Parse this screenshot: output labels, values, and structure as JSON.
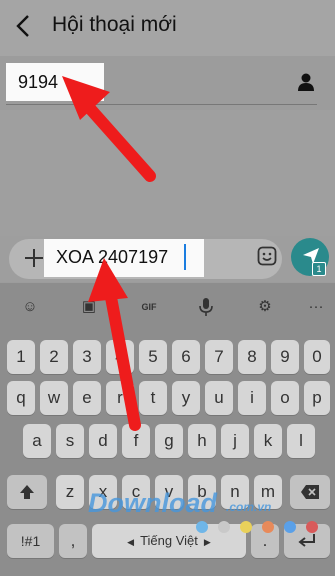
{
  "header": {
    "title": "Hội thoại mới",
    "back_icon": "back-arrow-icon"
  },
  "recipient": {
    "value": "9194",
    "contact_icon": "person-icon"
  },
  "compose": {
    "input_value": "XOA 2407197",
    "plus_icon": "plus-icon",
    "sticker_icon": "sticker-icon",
    "send_icon": "send-icon",
    "send_badge": "1"
  },
  "keyboard": {
    "toolbar": [
      "emoji-icon",
      "image-icon",
      "GIF",
      "mic-icon",
      "settings-icon",
      "more-icon"
    ],
    "gif_label": "GIF",
    "row_numbers": [
      "1",
      "2",
      "3",
      "4",
      "5",
      "6",
      "7",
      "8",
      "9",
      "0"
    ],
    "row_q": [
      "q",
      "w",
      "e",
      "r",
      "t",
      "y",
      "u",
      "i",
      "o",
      "p"
    ],
    "row_a": [
      "a",
      "s",
      "d",
      "f",
      "g",
      "h",
      "j",
      "k",
      "l"
    ],
    "row_z": [
      "z",
      "x",
      "c",
      "v",
      "b",
      "n",
      "m"
    ],
    "symbols_label": "!#1",
    "comma_label": ",",
    "space_label": "Tiếng Việt",
    "period_label": ".",
    "enter_icon": "enter-icon",
    "shift_icon": "shift-icon",
    "backspace_icon": "backspace-icon"
  },
  "watermark": {
    "brand": "Download",
    "domain": ".com.vn",
    "dot_colors": [
      "#6fb6e8",
      "#c9c9c9",
      "#e9d15a",
      "#e88a5a",
      "#5aa0e8",
      "#d85a5a"
    ]
  },
  "annotation_color": "#ee1c1c"
}
